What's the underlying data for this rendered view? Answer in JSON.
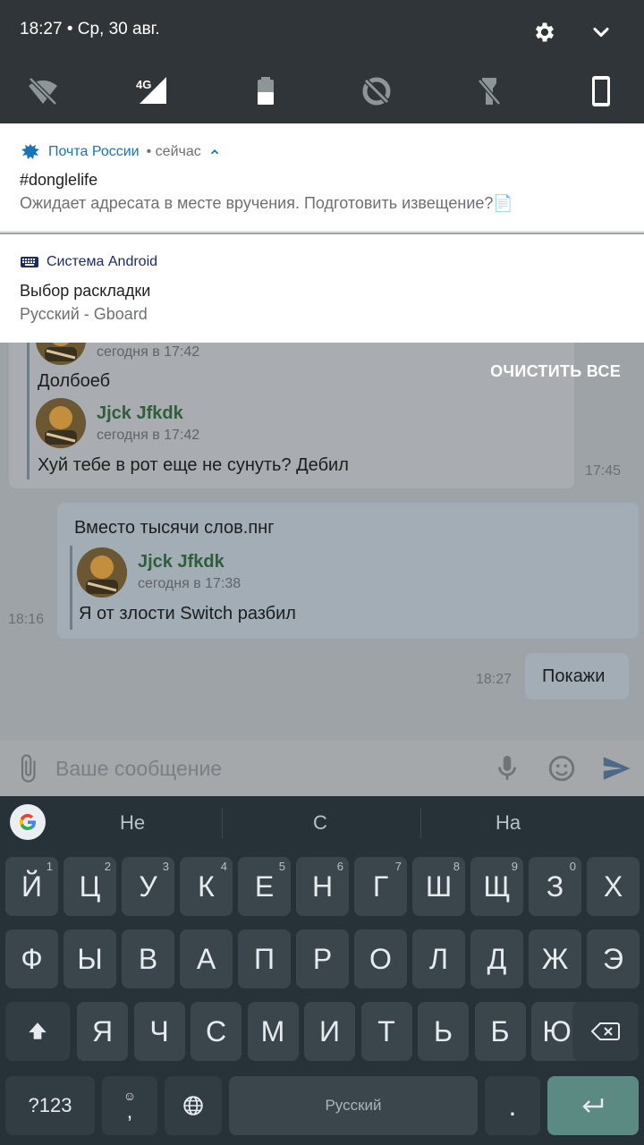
{
  "status_bar": {
    "time_date": "18:27 • Ср, 30 авг."
  },
  "quick_settings": {
    "tiles": [
      "wifi-off-icon",
      "mobile-signal-icon",
      "battery-icon",
      "data-saver-icon",
      "flashlight-icon",
      "phone-icon"
    ],
    "network_label": "4G"
  },
  "notifications": [
    {
      "app": "Почта России",
      "when": "• сейчас",
      "title": "#donglelife",
      "body": "Ожидает адресата в месте вручения. Подготовить извещение?📄",
      "app_color": "#1a73b5"
    },
    {
      "app": "Система Android",
      "title": "Выбор раскладки",
      "body": "Русский - Gboard",
      "app_color": "#1f2a6b"
    }
  ],
  "clear_all": "ОЧИСТИТЬ ВСЕ",
  "chat": {
    "msg1": {
      "quote_time_1": "сегодня в 17:42",
      "line1": "Долбоеб",
      "quote_name": "Jjck Jfkdk",
      "quote_time_2": "сегодня в 17:42",
      "line2": "Хуй тебе в рот еще не сунуть?  Дебил",
      "stamp": "17:45"
    },
    "msg2": {
      "text": "Вместо тысячи слов.пнг",
      "quote_name": "Jjck Jfkdk",
      "quote_time": "сегодня в 17:38",
      "quote_text": "Я от злости Switch разбил",
      "stamp": "18:16"
    },
    "msg3": {
      "text": "Покажи",
      "stamp": "18:27"
    },
    "input_placeholder": "Ваше сообщение"
  },
  "keyboard": {
    "suggestions": [
      "Не",
      "С",
      "На"
    ],
    "row1": [
      "Й",
      "Ц",
      "У",
      "К",
      "Е",
      "Н",
      "Г",
      "Ш",
      "Щ",
      "З",
      "Х"
    ],
    "row1_hints": [
      "1",
      "2",
      "3",
      "4",
      "5",
      "6",
      "7",
      "8",
      "9",
      "0",
      ""
    ],
    "row2": [
      "Ф",
      "Ы",
      "В",
      "А",
      "П",
      "Р",
      "О",
      "Л",
      "Д",
      "Ж",
      "Э"
    ],
    "row3": [
      "Я",
      "Ч",
      "С",
      "М",
      "И",
      "Т",
      "Ь",
      "Б",
      "Ю"
    ],
    "symbols_key": "?123",
    "comma_key": ",",
    "space_label": "Русский",
    "period_key": "."
  }
}
